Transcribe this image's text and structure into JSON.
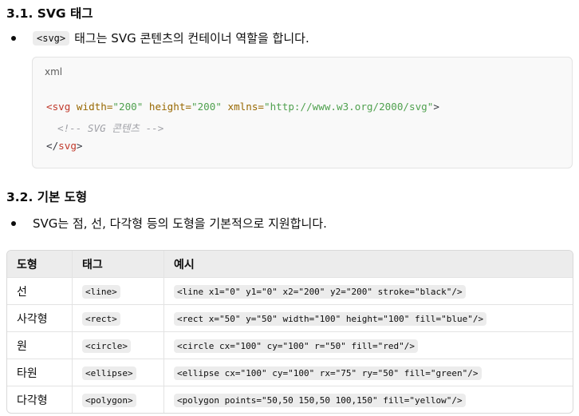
{
  "section1": {
    "heading": "3.1. SVG 태그",
    "bullet_code": "<svg>",
    "bullet_text": "태그는 SVG 콘텐츠의 컨테이너 역할을 합니다.",
    "code_lang": "xml",
    "code": {
      "l1_tag_open": "<svg",
      "l1_attr1": " width=",
      "l1_val1": "\"200\"",
      "l1_attr2": " height=",
      "l1_val2": "\"200\"",
      "l1_attr3": " xmlns=",
      "l1_val3": "\"http://www.w3.org/2000/svg\"",
      "l1_close": ">",
      "l2_comment": "<!-- SVG 콘텐츠 -->",
      "l3_tag_close_open": "</",
      "l3_tag_name": "svg",
      "l3_close": ">"
    }
  },
  "section2": {
    "heading": "3.2. 기본 도형",
    "bullet_text": "SVG는 점, 선, 다각형 등의 도형을 기본적으로 지원합니다."
  },
  "table": {
    "headers": [
      "도형",
      "태그",
      "예시"
    ],
    "rows": [
      {
        "shape": "선",
        "tag": "<line>",
        "example": "<line x1=\"0\" y1=\"0\" x2=\"200\" y2=\"200\" stroke=\"black\"/>"
      },
      {
        "shape": "사각형",
        "tag": "<rect>",
        "example": "<rect x=\"50\" y=\"50\" width=\"100\" height=\"100\" fill=\"blue\"/>"
      },
      {
        "shape": "원",
        "tag": "<circle>",
        "example": "<circle cx=\"100\" cy=\"100\" r=\"50\" fill=\"red\"/>"
      },
      {
        "shape": "타원",
        "tag": "<ellipse>",
        "example": "<ellipse cx=\"100\" cy=\"100\" rx=\"75\" ry=\"50\" fill=\"green\"/>"
      },
      {
        "shape": "다각형",
        "tag": "<polygon>",
        "example": "<polygon points=\"50,50 150,50 100,150\" fill=\"yellow\"/>"
      }
    ]
  }
}
